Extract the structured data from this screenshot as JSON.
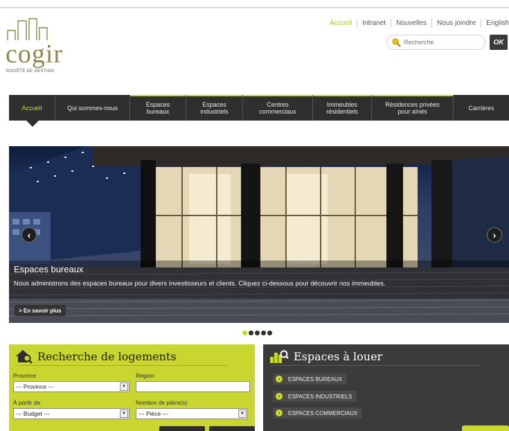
{
  "logo": {
    "word": "cogir",
    "subtitle": "SOCIÉTÉ DE GESTION"
  },
  "toplinks": [
    "Accueil",
    "Intranet",
    "Nouvelles",
    "Nous joindre",
    "English"
  ],
  "search": {
    "placeholder": "Recherche",
    "button": "OK"
  },
  "nav": {
    "items": [
      {
        "label": "Accueil",
        "active": true
      },
      {
        "label": "Qui sommes-nous"
      },
      {
        "label": "Espaces bureaux"
      },
      {
        "label": "Espaces industriels"
      },
      {
        "label": "Centres commerciaux"
      },
      {
        "label": "Immeubles résidentiels"
      },
      {
        "label": "Résidences privées pour aînés"
      },
      {
        "label": "Carrières"
      }
    ]
  },
  "hero": {
    "title": "Espaces bureaux",
    "description": "Nous administrons des espaces bureaux pour divers investisseurs et clients. Cliquez ci-dessous pour découvrir nos immeubles.",
    "more_label": "> En savoir plus",
    "prev": "‹",
    "next": "›"
  },
  "slider": {
    "total": 5,
    "active": 1
  },
  "search_panel": {
    "title": "Recherche de logements",
    "province_label": "Province",
    "province_value": "--- Province ---",
    "region_label": "Région",
    "budget_label": "À partir de",
    "budget_value": "--- Budget ---",
    "rooms_label": "Nombre de pièce(s)",
    "rooms_value": "--- Pièce ---"
  },
  "rent_panel": {
    "title": "Espaces à louer",
    "items": [
      "ESPACES BUREAUX",
      "ESPACES INDUSTRIELS",
      "ESPACES COMMERCIAUX"
    ]
  },
  "colors": {
    "accent": "#c9d92a",
    "dark": "#2f2f2f",
    "logo": "#8a8a4e"
  }
}
